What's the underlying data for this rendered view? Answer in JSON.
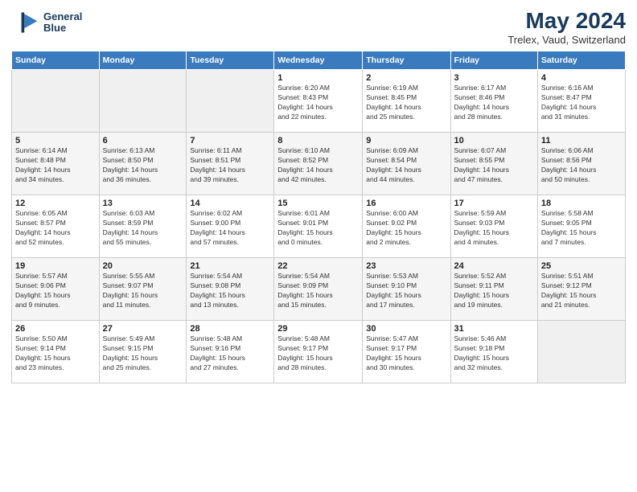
{
  "logo": {
    "line1": "General",
    "line2": "Blue"
  },
  "title": "May 2024",
  "subtitle": "Trelex, Vaud, Switzerland",
  "days_header": [
    "Sunday",
    "Monday",
    "Tuesday",
    "Wednesday",
    "Thursday",
    "Friday",
    "Saturday"
  ],
  "weeks": [
    [
      {
        "day": "",
        "info": ""
      },
      {
        "day": "",
        "info": ""
      },
      {
        "day": "",
        "info": ""
      },
      {
        "day": "1",
        "info": "Sunrise: 6:20 AM\nSunset: 8:43 PM\nDaylight: 14 hours\nand 22 minutes."
      },
      {
        "day": "2",
        "info": "Sunrise: 6:19 AM\nSunset: 8:45 PM\nDaylight: 14 hours\nand 25 minutes."
      },
      {
        "day": "3",
        "info": "Sunrise: 6:17 AM\nSunset: 8:46 PM\nDaylight: 14 hours\nand 28 minutes."
      },
      {
        "day": "4",
        "info": "Sunrise: 6:16 AM\nSunset: 8:47 PM\nDaylight: 14 hours\nand 31 minutes."
      }
    ],
    [
      {
        "day": "5",
        "info": "Sunrise: 6:14 AM\nSunset: 8:48 PM\nDaylight: 14 hours\nand 34 minutes."
      },
      {
        "day": "6",
        "info": "Sunrise: 6:13 AM\nSunset: 8:50 PM\nDaylight: 14 hours\nand 36 minutes."
      },
      {
        "day": "7",
        "info": "Sunrise: 6:11 AM\nSunset: 8:51 PM\nDaylight: 14 hours\nand 39 minutes."
      },
      {
        "day": "8",
        "info": "Sunrise: 6:10 AM\nSunset: 8:52 PM\nDaylight: 14 hours\nand 42 minutes."
      },
      {
        "day": "9",
        "info": "Sunrise: 6:09 AM\nSunset: 8:54 PM\nDaylight: 14 hours\nand 44 minutes."
      },
      {
        "day": "10",
        "info": "Sunrise: 6:07 AM\nSunset: 8:55 PM\nDaylight: 14 hours\nand 47 minutes."
      },
      {
        "day": "11",
        "info": "Sunrise: 6:06 AM\nSunset: 8:56 PM\nDaylight: 14 hours\nand 50 minutes."
      }
    ],
    [
      {
        "day": "12",
        "info": "Sunrise: 6:05 AM\nSunset: 8:57 PM\nDaylight: 14 hours\nand 52 minutes."
      },
      {
        "day": "13",
        "info": "Sunrise: 6:03 AM\nSunset: 8:59 PM\nDaylight: 14 hours\nand 55 minutes."
      },
      {
        "day": "14",
        "info": "Sunrise: 6:02 AM\nSunset: 9:00 PM\nDaylight: 14 hours\nand 57 minutes."
      },
      {
        "day": "15",
        "info": "Sunrise: 6:01 AM\nSunset: 9:01 PM\nDaylight: 15 hours\nand 0 minutes."
      },
      {
        "day": "16",
        "info": "Sunrise: 6:00 AM\nSunset: 9:02 PM\nDaylight: 15 hours\nand 2 minutes."
      },
      {
        "day": "17",
        "info": "Sunrise: 5:59 AM\nSunset: 9:03 PM\nDaylight: 15 hours\nand 4 minutes."
      },
      {
        "day": "18",
        "info": "Sunrise: 5:58 AM\nSunset: 9:05 PM\nDaylight: 15 hours\nand 7 minutes."
      }
    ],
    [
      {
        "day": "19",
        "info": "Sunrise: 5:57 AM\nSunset: 9:06 PM\nDaylight: 15 hours\nand 9 minutes."
      },
      {
        "day": "20",
        "info": "Sunrise: 5:55 AM\nSunset: 9:07 PM\nDaylight: 15 hours\nand 11 minutes."
      },
      {
        "day": "21",
        "info": "Sunrise: 5:54 AM\nSunset: 9:08 PM\nDaylight: 15 hours\nand 13 minutes."
      },
      {
        "day": "22",
        "info": "Sunrise: 5:54 AM\nSunset: 9:09 PM\nDaylight: 15 hours\nand 15 minutes."
      },
      {
        "day": "23",
        "info": "Sunrise: 5:53 AM\nSunset: 9:10 PM\nDaylight: 15 hours\nand 17 minutes."
      },
      {
        "day": "24",
        "info": "Sunrise: 5:52 AM\nSunset: 9:11 PM\nDaylight: 15 hours\nand 19 minutes."
      },
      {
        "day": "25",
        "info": "Sunrise: 5:51 AM\nSunset: 9:12 PM\nDaylight: 15 hours\nand 21 minutes."
      }
    ],
    [
      {
        "day": "26",
        "info": "Sunrise: 5:50 AM\nSunset: 9:14 PM\nDaylight: 15 hours\nand 23 minutes."
      },
      {
        "day": "27",
        "info": "Sunrise: 5:49 AM\nSunset: 9:15 PM\nDaylight: 15 hours\nand 25 minutes."
      },
      {
        "day": "28",
        "info": "Sunrise: 5:48 AM\nSunset: 9:16 PM\nDaylight: 15 hours\nand 27 minutes."
      },
      {
        "day": "29",
        "info": "Sunrise: 5:48 AM\nSunset: 9:17 PM\nDaylight: 15 hours\nand 28 minutes."
      },
      {
        "day": "30",
        "info": "Sunrise: 5:47 AM\nSunset: 9:17 PM\nDaylight: 15 hours\nand 30 minutes."
      },
      {
        "day": "31",
        "info": "Sunrise: 5:46 AM\nSunset: 9:18 PM\nDaylight: 15 hours\nand 32 minutes."
      },
      {
        "day": "",
        "info": ""
      }
    ]
  ]
}
